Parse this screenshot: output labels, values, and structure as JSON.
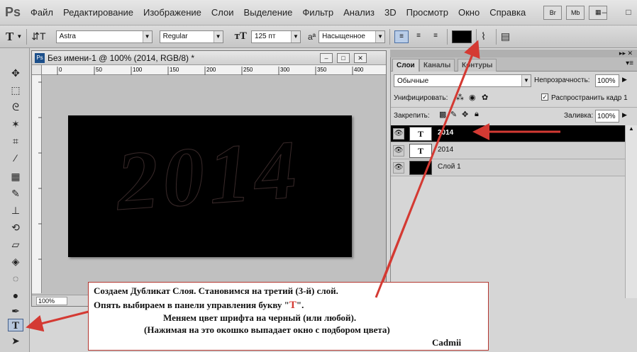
{
  "app": {
    "logo": "Ps"
  },
  "menu": {
    "items": [
      "Файл",
      "Редактирование",
      "Изображение",
      "Слои",
      "Выделение",
      "Фильтр",
      "Анализ",
      "3D",
      "Просмотр",
      "Окно",
      "Справка"
    ],
    "bridge": "Br",
    "minibridge": "Mb"
  },
  "options": {
    "tool_glyph": "T",
    "font_family": "Astra",
    "font_style": "Regular",
    "font_size": "125 пт",
    "aa_label": "aª",
    "aa_value": "Насыщенное",
    "text_color": "#000000"
  },
  "document": {
    "title": "Без имени-1 @ 100% (2014, RGB/8) *",
    "zoom": "100%",
    "canvas_text": "2014",
    "ruler_ticks": [
      "0",
      "50",
      "100",
      "150",
      "200",
      "250",
      "300",
      "350",
      "400"
    ]
  },
  "layers_panel": {
    "tabs": [
      "Слои",
      "Каналы",
      "Контуры"
    ],
    "blend_mode": "Обычные",
    "opacity_label": "Непрозрачность:",
    "opacity_value": "100%",
    "unify_label": "Унифицировать:",
    "propagate_label": "Распространить кадр 1",
    "lock_label": "Закрепить:",
    "fill_label": "Заливка:",
    "fill_value": "100%",
    "layers": [
      {
        "name": "2014",
        "thumb": "T",
        "selected": true
      },
      {
        "name": "2014",
        "thumb": "T",
        "selected": false
      },
      {
        "name": "Слой 1",
        "thumb": "",
        "selected": false
      }
    ]
  },
  "note": {
    "line1": "Создаем Дубликат Слоя. Становимся на третий   (3-й) слой.",
    "line2a": "Опять выбираем в панели управления букву \"",
    "line2b": "Т",
    "line2c": "\".",
    "line3": "Меняем цвет шрифта на черный (или любой).",
    "line4": "(Нажимая на это окошко выпадает окно с подбором цвета)",
    "signature": "Cadmii"
  },
  "colors": {
    "arrow": "#d43a33",
    "note_border": "#b3362f"
  }
}
